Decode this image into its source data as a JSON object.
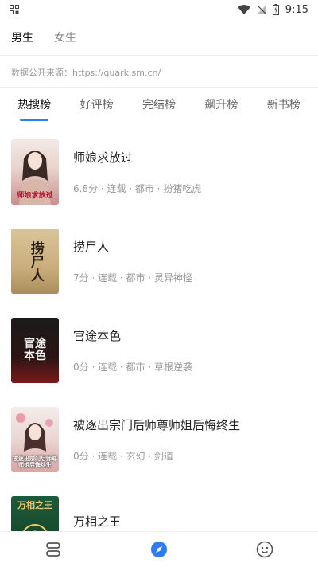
{
  "status": {
    "time": "9:15"
  },
  "gender_tabs": [
    {
      "label": "男生",
      "active": true
    },
    {
      "label": "女生",
      "active": false
    }
  ],
  "source_text": "数据公开来源：https://quark.sm.cn/",
  "rank_tabs": [
    {
      "label": "热搜榜",
      "active": true
    },
    {
      "label": "好评榜",
      "active": false
    },
    {
      "label": "完结榜",
      "active": false
    },
    {
      "label": "飙升榜",
      "active": false
    },
    {
      "label": "新书榜",
      "active": false
    }
  ],
  "books": [
    {
      "title": "师娘求放过",
      "meta": "6.8分 · 连载 · 都市 · 扮猪吃虎",
      "cover_text": "师娘求放过"
    },
    {
      "title": "捞尸人",
      "meta": "7分 · 连载 · 都市 · 灵异神怪",
      "cover_text": "捞尸人"
    },
    {
      "title": "官途本色",
      "meta": "0分 · 连载 · 都市 · 草根逆袭",
      "cover_text": "官途本色"
    },
    {
      "title": "被逐出宗门后师尊师姐后悔终生",
      "meta": "0分 · 连载 · 玄幻 · 剑道",
      "cover_text": "被逐出宗门后师尊师姐后悔终生"
    },
    {
      "title": "万相之王",
      "meta": "",
      "cover_text": "万相之王"
    }
  ],
  "colors": {
    "accent": "#2d7cf6"
  },
  "bottom_nav": [
    {
      "icon": "bookshelf-icon",
      "active": false
    },
    {
      "icon": "compass-icon",
      "active": true
    },
    {
      "icon": "smiley-icon",
      "active": false
    }
  ]
}
